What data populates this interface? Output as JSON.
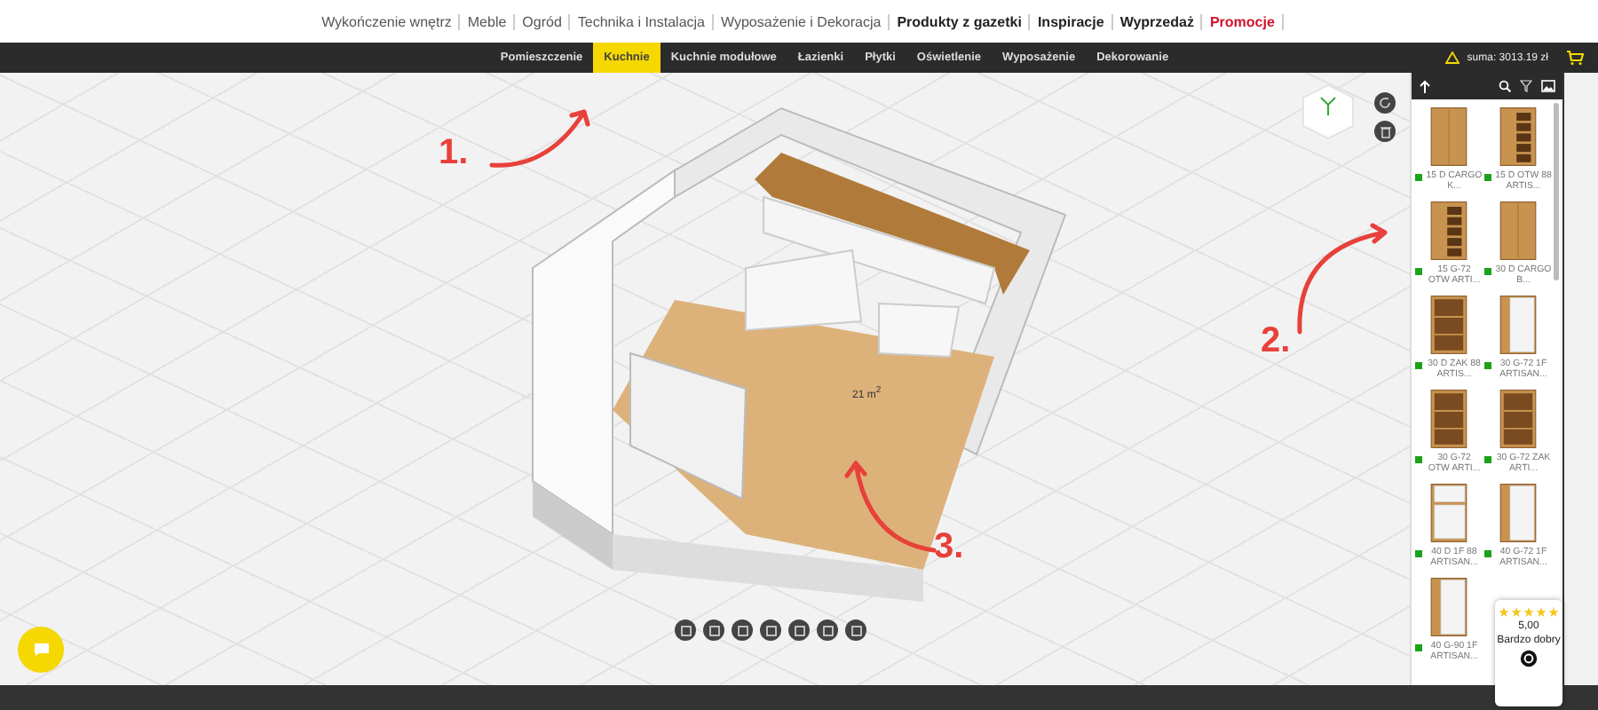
{
  "top_menu": [
    {
      "label": "Wykończenie wnętrz",
      "kind": "regular"
    },
    {
      "label": "Meble",
      "kind": "regular"
    },
    {
      "label": "Ogród",
      "kind": "regular"
    },
    {
      "label": "Technika i Instalacja",
      "kind": "regular"
    },
    {
      "label": "Wyposażenie i Dekoracja",
      "kind": "regular"
    },
    {
      "label": "Produkty z gazetki",
      "kind": "bold"
    },
    {
      "label": "Inspiracje",
      "kind": "bold"
    },
    {
      "label": "Wyprzedaż",
      "kind": "bold"
    },
    {
      "label": "Promocje",
      "kind": "promo"
    }
  ],
  "tabs": [
    {
      "label": "Pomieszczenie",
      "selected": false
    },
    {
      "label": "Kuchnie",
      "selected": true
    },
    {
      "label": "Kuchnie modułowe",
      "selected": false
    },
    {
      "label": "Łazienki",
      "selected": false
    },
    {
      "label": "Płytki",
      "selected": false
    },
    {
      "label": "Oświetlenie",
      "selected": false
    },
    {
      "label": "Wyposażenie",
      "selected": false
    },
    {
      "label": "Dekorowanie",
      "selected": false
    }
  ],
  "summary": {
    "total": "suma: 3013.19 zł"
  },
  "canvas": {
    "area_label": "21 m$^{2}$",
    "annotations": [
      "1.",
      "2.",
      "3."
    ]
  },
  "products": [
    {
      "name": "15 D CARGO K...",
      "kind": "closed"
    },
    {
      "name": "15 D OTW 88 ARTIS...",
      "kind": "rack"
    },
    {
      "name": "15 G-72 OTW ARTI...",
      "kind": "rack"
    },
    {
      "name": "30 D CARGO B...",
      "kind": "closed"
    },
    {
      "name": "30 D ZAK 88 ARTIS...",
      "kind": "open"
    },
    {
      "name": "30 G-72 1F ARTISAN...",
      "kind": "white"
    },
    {
      "name": "30 G-72 OTW ARTI...",
      "kind": "open"
    },
    {
      "name": "30 G-72 ZAK ARTI...",
      "kind": "open"
    },
    {
      "name": "40 D 1F 88 ARTISAN...",
      "kind": "drawer"
    },
    {
      "name": "40 G-72 1F ARTISAN...",
      "kind": "white"
    },
    {
      "name": "40 G-90 1F ARTISAN...",
      "kind": "white"
    }
  ],
  "rating": {
    "stars": 5,
    "score": "5,00",
    "verdict": "Bardzo dobry"
  }
}
